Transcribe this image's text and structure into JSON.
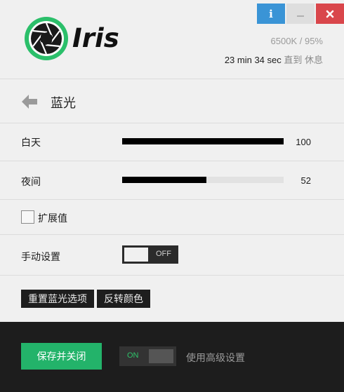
{
  "colors": {
    "accent_green": "#23b36a",
    "info_blue": "#3a94d6",
    "close_red": "#d9464b",
    "slider_fill": "#000000",
    "footer_bg": "#1d1d1d"
  },
  "header": {
    "brand": "Iris",
    "window_buttons": {
      "info": "i",
      "minimize": "–",
      "close": "✖"
    },
    "status": {
      "temperature_brightness": "6500K / 95%",
      "countdown": "23 min 34 sec",
      "countdown_suffix": "直到 休息"
    }
  },
  "page": {
    "title": "蓝光",
    "back_icon": "back-arrow-icon"
  },
  "settings": {
    "day": {
      "label": "白天",
      "value": "100",
      "level_percent": 100
    },
    "night": {
      "label": "夜间",
      "value": "52",
      "level_percent": 52
    },
    "extended": {
      "label": "扩展值",
      "checked": false
    },
    "manual": {
      "label": "手动设置",
      "toggle_text": "OFF",
      "on": false
    },
    "actions": {
      "reset_label": "重置蓝光选项",
      "invert_label": "反转颜色"
    }
  },
  "footer": {
    "save_label": "保存并关闭",
    "advanced_toggle_text": "ON",
    "advanced_on": true,
    "advanced_label": "使用高级设置"
  }
}
